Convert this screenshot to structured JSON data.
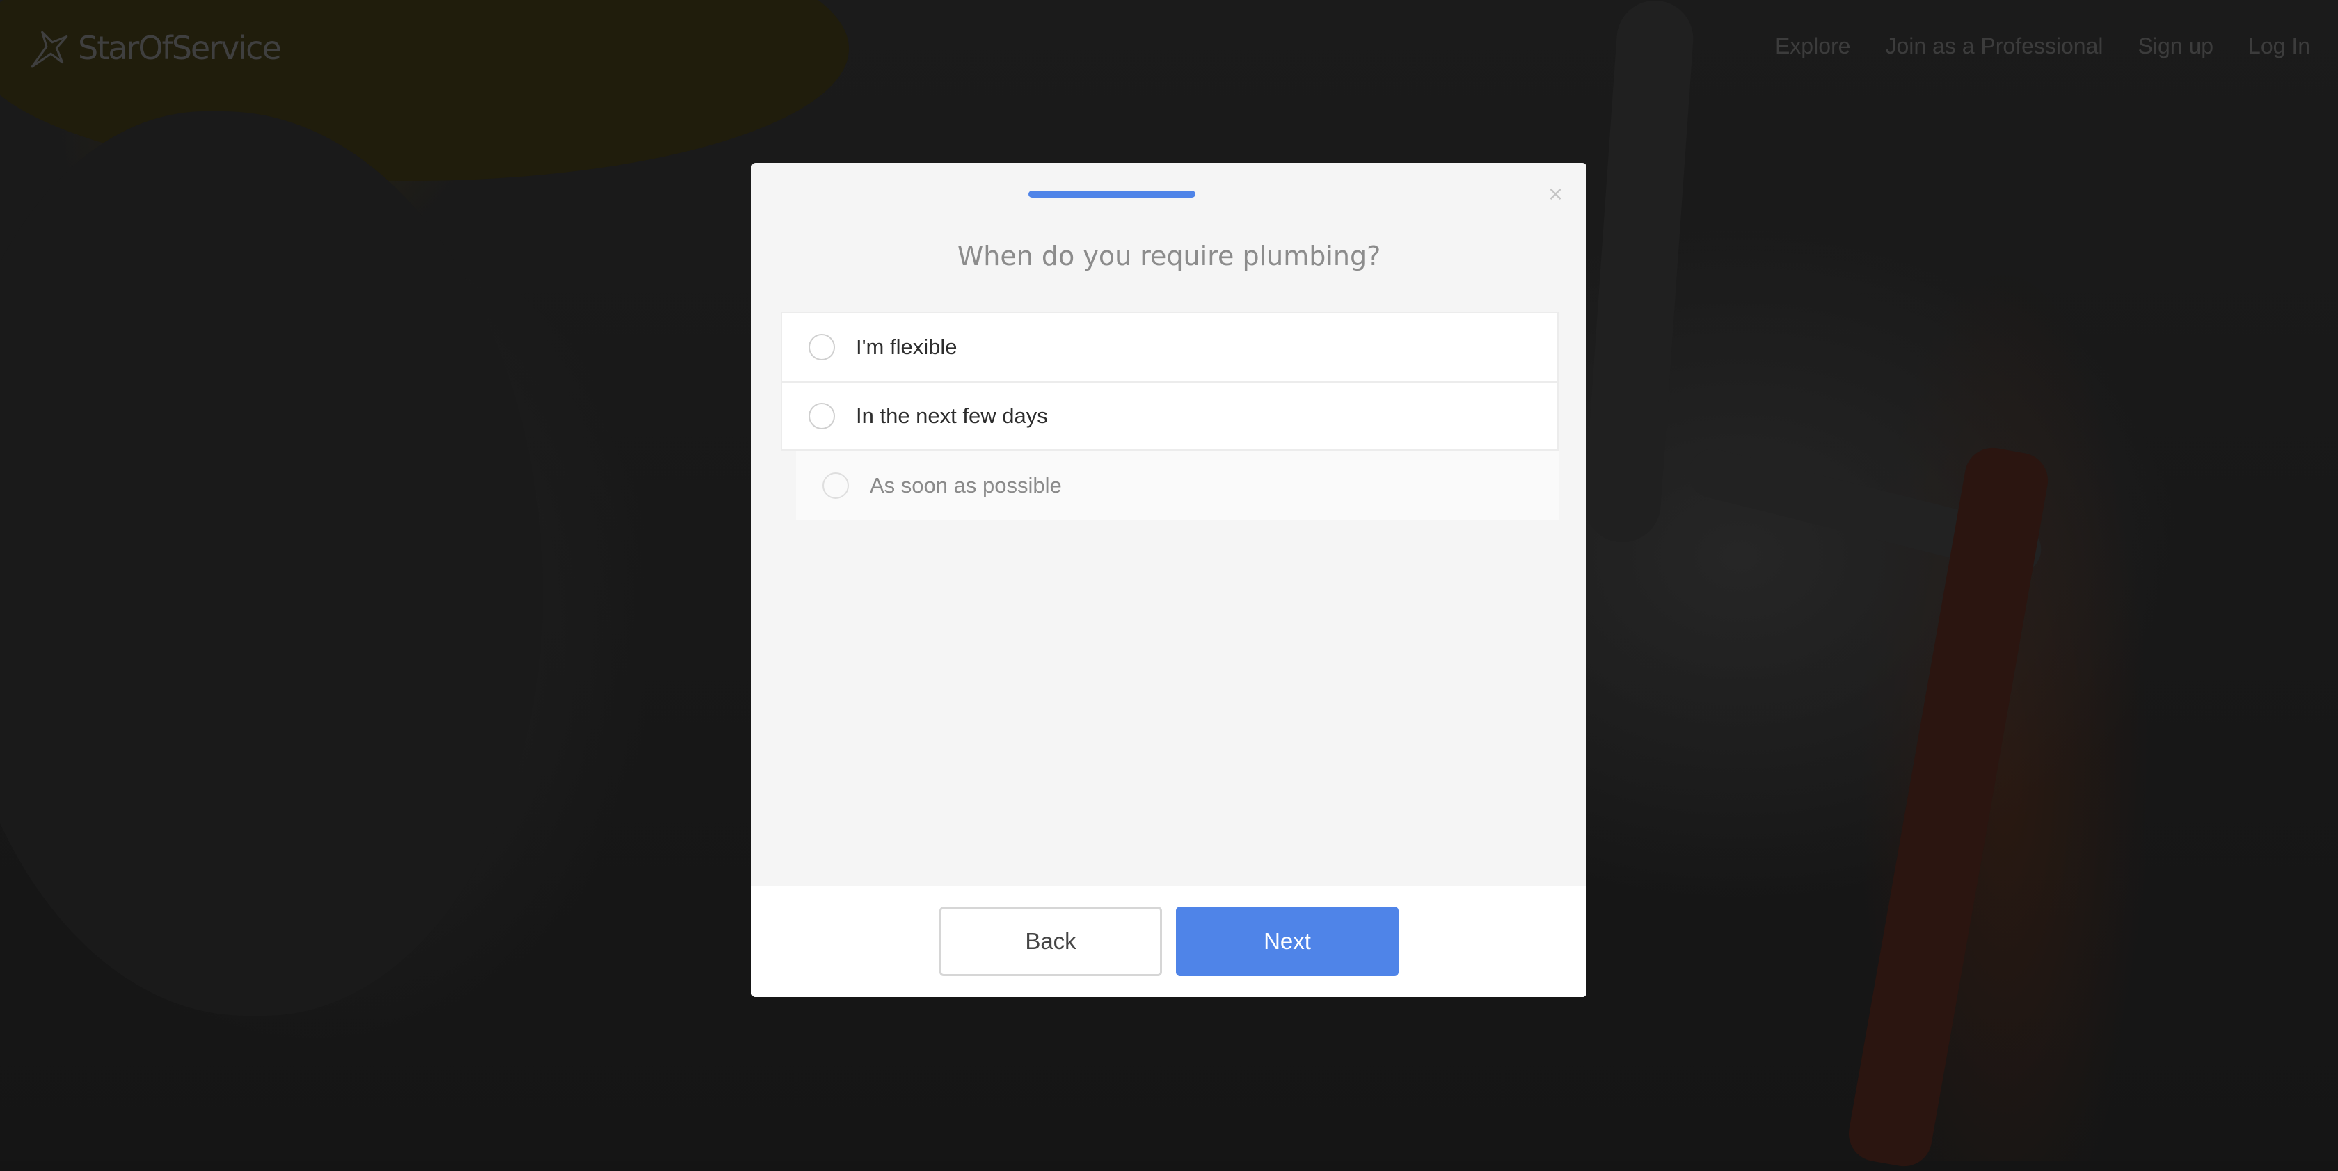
{
  "brand": {
    "name": "StarOfService",
    "icon": "star-logo-icon"
  },
  "nav": {
    "items": [
      "Explore",
      "Join as a Professional",
      "Sign up",
      "Log In"
    ]
  },
  "modal": {
    "progress": 0.2,
    "close_icon": "close-icon",
    "close_glyph": "×",
    "question": "When do you require plumbing?",
    "options": [
      {
        "label": "I'm flexible",
        "selected": false
      },
      {
        "label": "In the next few days",
        "selected": false
      },
      {
        "label": "As soon as possible",
        "selected": false
      }
    ],
    "back_label": "Back",
    "next_label": "Next"
  },
  "colors": {
    "accent": "#4f84e8",
    "overlay": "#141414",
    "modal_bg": "#f5f5f5"
  }
}
